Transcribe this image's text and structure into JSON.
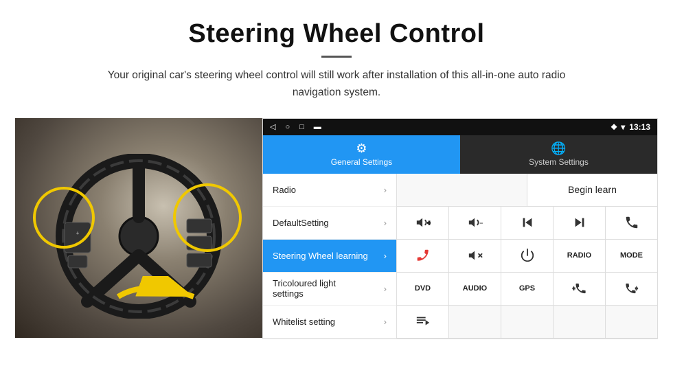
{
  "header": {
    "title": "Steering Wheel Control",
    "subtitle": "Your original car's steering wheel control will still work after installation of this all-in-one auto radio navigation system."
  },
  "status_bar": {
    "nav_back": "◁",
    "nav_home": "○",
    "nav_recent": "□",
    "nav_screen": "▬",
    "wifi": "▾",
    "signal": "▲",
    "time": "13:13"
  },
  "tabs": [
    {
      "id": "general",
      "label": "General Settings",
      "active": true
    },
    {
      "id": "system",
      "label": "System Settings",
      "active": false
    }
  ],
  "menu": [
    {
      "id": "radio",
      "label": "Radio",
      "active": false
    },
    {
      "id": "default-setting",
      "label": "DefaultSetting",
      "active": false
    },
    {
      "id": "steering-wheel",
      "label": "Steering Wheel learning",
      "active": true
    },
    {
      "id": "tricoloured",
      "label": "Tricoloured light settings",
      "active": false
    },
    {
      "id": "whitelist",
      "label": "Whitelist setting",
      "active": false
    }
  ],
  "buttons": {
    "begin_learn": "Begin learn",
    "row2": [
      "vol_up",
      "vol_down",
      "prev",
      "next",
      "phone"
    ],
    "row3": [
      "hang_up",
      "mute",
      "power",
      "RADIO",
      "MODE"
    ],
    "row4": [
      "DVD",
      "AUDIO",
      "GPS",
      "tel_prev",
      "tel_next"
    ],
    "row5": [
      "playlist"
    ]
  }
}
